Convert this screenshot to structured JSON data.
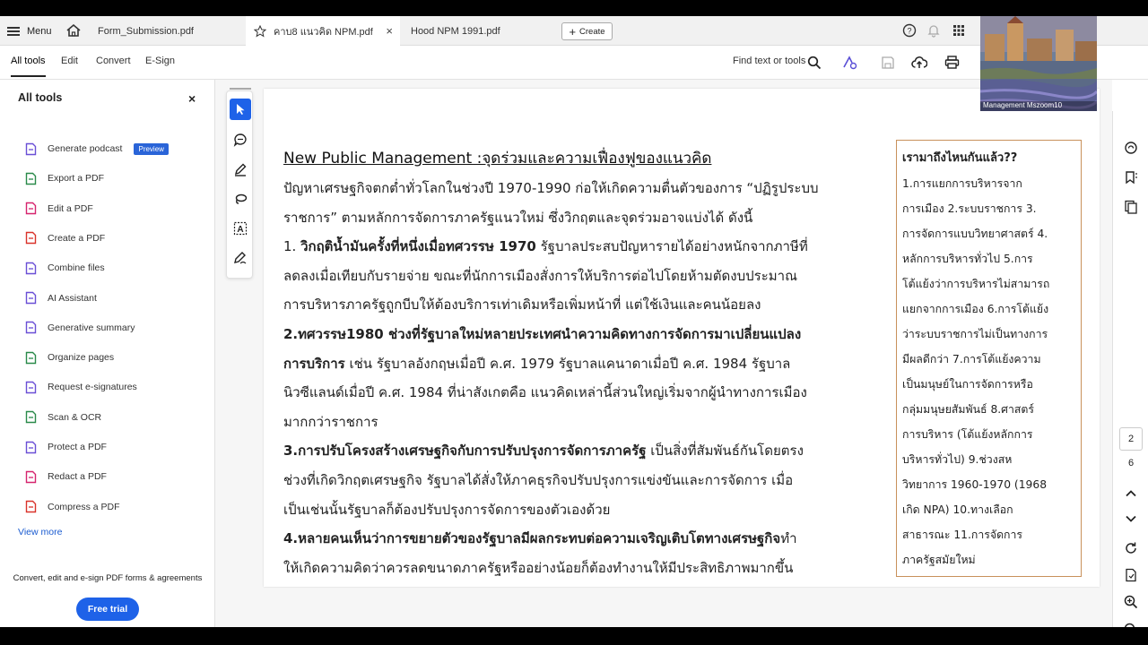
{
  "tabbar": {
    "menu_label": "Menu",
    "tabs": [
      {
        "label": "Form_Submission.pdf"
      },
      {
        "label": "คาบ8 แนวคิด NPM.pdf"
      },
      {
        "label": "Hood NPM 1991.pdf"
      }
    ],
    "close_glyph": "×",
    "create_label": "Create"
  },
  "toolbar": {
    "tabs": [
      "All tools",
      "Edit",
      "Convert",
      "E-Sign"
    ],
    "find_label": "Find text or tools"
  },
  "sidebar": {
    "title": "All tools",
    "close_glyph": "×",
    "items": [
      {
        "label": "Generate podcast",
        "badge": "Preview",
        "icon": "podcast-icon",
        "color": "#6a4fd6"
      },
      {
        "label": "Export a PDF",
        "icon": "export-pdf-icon",
        "color": "#2a8a4a"
      },
      {
        "label": "Edit a PDF",
        "icon": "edit-pdf-icon",
        "color": "#d6246e"
      },
      {
        "label": "Create a PDF",
        "icon": "create-pdf-icon",
        "color": "#d9332b"
      },
      {
        "label": "Combine files",
        "icon": "combine-icon",
        "color": "#6a4fd6"
      },
      {
        "label": "AI Assistant",
        "icon": "ai-assistant-icon",
        "color": "#6a4fd6"
      },
      {
        "label": "Generative summary",
        "icon": "summary-icon",
        "color": "#6a4fd6"
      },
      {
        "label": "Organize pages",
        "icon": "organize-icon",
        "color": "#2a8a4a"
      },
      {
        "label": "Request e-signatures",
        "icon": "e-sign-icon",
        "color": "#6a4fd6"
      },
      {
        "label": "Scan & OCR",
        "icon": "scan-icon",
        "color": "#2a8a4a"
      },
      {
        "label": "Protect a PDF",
        "icon": "protect-icon",
        "color": "#6a4fd6"
      },
      {
        "label": "Redact a PDF",
        "icon": "redact-icon",
        "color": "#d6246e"
      },
      {
        "label": "Compress a PDF",
        "icon": "compress-icon",
        "color": "#d9332b"
      }
    ],
    "view_more": "View more",
    "promo_text": "Convert, edit and e-sign PDF forms & agreements",
    "trial_label": "Free trial"
  },
  "document": {
    "title": "New Public Management :จุดร่วมและความเฟื่องฟูของแนวคิด",
    "lines": [
      {
        "bold": "",
        "text": "ปัญหาเศรษฐกิจตกต่ำทั่วโลกในช่วงปี 1970-1990 ก่อให้เกิดความตื่นตัวของการ “ปฏิรูประบบ"
      },
      {
        "bold": "",
        "text": "ราชการ” ตามหลักการจัดการภาครัฐแนวใหม่ ซึ่งวิกฤตและจุดร่วมอาจแบ่งได้ ดังนี้"
      },
      {
        "pre": "1. ",
        "bold": "วิกฤติน้ำมันครั้งที่หนึ่งเมื่อทศวรรษ 1970",
        "text": " รัฐบาลประสบปัญหารายได้อย่างหนักจากภาษีที่"
      },
      {
        "bold": "",
        "text": "ลดลงเมื่อเทียบกับรายจ่าย ขณะที่นักการเมืองสั่งการให้บริการต่อไปโดยห้ามตัดงบประมาณ"
      },
      {
        "bold": "",
        "text": "การบริหารภาครัฐถูกบีบให้ต้องบริการเท่าเดิมหรือเพิ่มหน้าที่ แต่ใช้เงินและคนน้อยลง"
      },
      {
        "bold": "2.ทศวรรษ1980 ช่วงที่รัฐบาลใหม่หลายประเทศนำความคิดทางการจัดการมาเปลี่ยนแปลง",
        "text": ""
      },
      {
        "bold": "การบริการ",
        "text": " เช่น รัฐบาลอังกฤษเมื่อปี ค.ศ. 1979 รัฐบาลแคนาดาเมื่อปี ค.ศ. 1984 รัฐบาล"
      },
      {
        "bold": "",
        "text": "นิวซีแลนด์เมื่อปี ค.ศ. 1984  ที่น่าสังเกตคือ แนวคิดเหล่านี้ส่วนใหญ่เริ่มจากผู้นำทางการเมือง"
      },
      {
        "bold": "",
        "text": "มากกว่าราชการ"
      },
      {
        "bold": "3.การปรับโครงสร้างเศรษฐกิจกับการปรับปรุงการจัดการภาครัฐ",
        "text": " เป็นสิ่งที่สัมพันธ์กันโดยตรง"
      },
      {
        "bold": "",
        "text": "ช่วงที่เกิดวิกฤตเศรษฐกิจ  รัฐบาลได้สั่งให้ภาคธุรกิจปรับปรุงการแข่งขันและการจัดการ  เมื่อ"
      },
      {
        "bold": "",
        "text": "เป็นเช่นนั้นรัฐบาลก็ต้องปรับปรุงการจัดการของตัวเองด้วย"
      },
      {
        "bold": "4.หลายคนเห็นว่าการขยายตัวของรัฐบาลมีผลกระทบต่อความเจริญเติบโตทางเศรษฐกิจ",
        "text": "ทำ"
      },
      {
        "bold": "",
        "text": "ให้เกิดความคิดว่าควรลดขนาดภาครัฐหรืออย่างน้อยก็ต้องทำงานให้มีประสิทธิภาพมากขึ้น"
      }
    ],
    "box_title": "เรามาถึงไหนกันแล้ว??",
    "box_lines": [
      "1.การแยกการบริหารจาก",
      "การเมือง 2.ระบบราชการ 3.",
      "การจัดการแบบวิทยาศาสตร์ 4.",
      "หลักการบริหารทั่วไป 5.การ",
      "โต้แย้งว่าการบริหารไม่สามารถ",
      "แยกจากการเมือง 6.การโต้แย้ง",
      "ว่าระบบราชการไม่เป็นทางการ",
      "มีผลดีกว่า 7.การโต้แย้งความ",
      "เป็นมนุษย์ในการจัดการหรือ",
      "กลุ่มมนุษยสัมพันธ์ 8.ศาสตร์",
      "การบริหาร (โต้แย้งหลักการ",
      "บริหารทั่วไป) 9.ช่วงสห",
      "วิทยาการ 1960-1970 (1968",
      "เกิด NPA) 10.ทางเลือก",
      "สาธารณะ 11.การจัดการ",
      "ภาครัฐสมัยใหม่"
    ]
  },
  "rail": {
    "current_page": "2",
    "total_pages": "6"
  },
  "video": {
    "label": "Management Mszoom10"
  }
}
